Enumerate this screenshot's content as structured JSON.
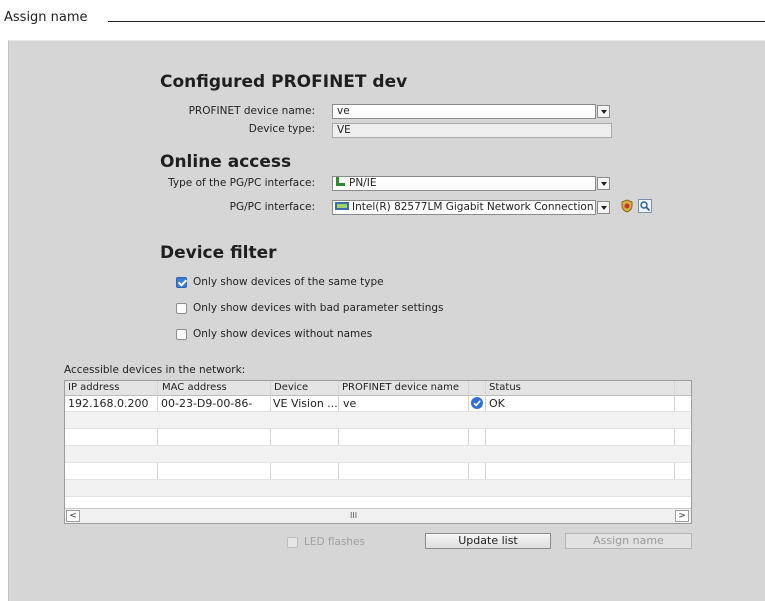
{
  "header": {
    "title": "Assign name"
  },
  "configured": {
    "title": "Configured PROFINET dev",
    "device_name_label": "PROFINET device name:",
    "device_name_value": "ve",
    "device_type_label": "Device type:",
    "device_type_value": "VE"
  },
  "online": {
    "title": "Online access",
    "iface_type_label": "Type of the PG/PC interface:",
    "iface_type_value": "PN/IE",
    "iface_label": "PG/PC interface:",
    "iface_value": "Intel(R) 82577LM Gigabit Network Connection"
  },
  "filter": {
    "title": "Device filter",
    "options": [
      {
        "label": "Only show devices of the same type",
        "checked": true
      },
      {
        "label": "Only show devices with bad parameter settings",
        "checked": false
      },
      {
        "label": "Only show devices without names",
        "checked": false
      }
    ]
  },
  "table": {
    "caption": "Accessible devices in the network:",
    "columns": [
      "IP address",
      "MAC address",
      "Device",
      "PROFINET device name",
      "Status"
    ],
    "rows": [
      {
        "ip": "192.168.0.200",
        "mac": "00-23-D9-00-86-",
        "device": "VE Vision ...",
        "name": "ve",
        "status": "OK"
      }
    ],
    "scroll_left": "<",
    "scroll_mid": "III",
    "scroll_right": ">"
  },
  "actions": {
    "led_label": "LED flashes",
    "update_label": "Update list",
    "assign_label": "Assign name"
  }
}
